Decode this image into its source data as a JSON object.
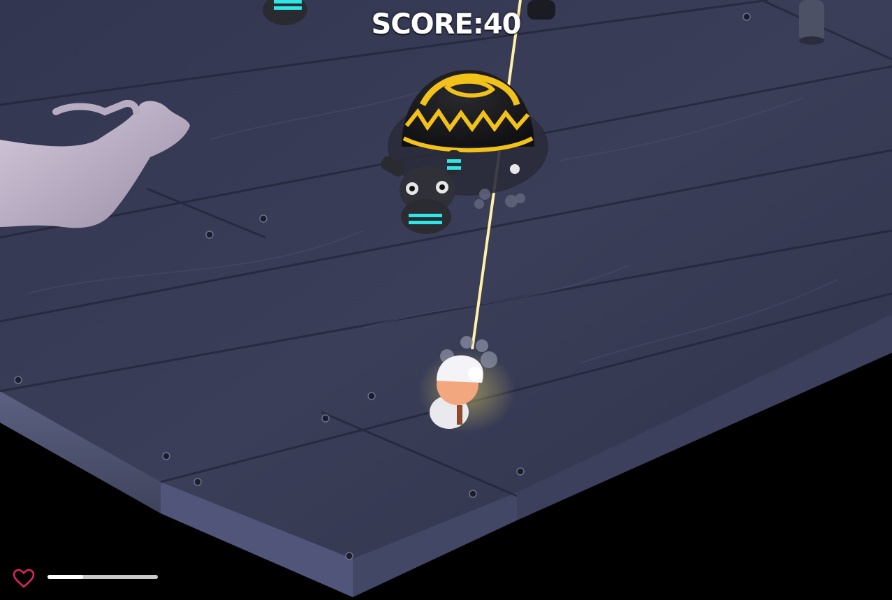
{
  "hud": {
    "score_label": "SCORE",
    "score_separator": ":",
    "score_value": "40",
    "health_fraction": 0.32
  },
  "colors": {
    "floor": "#3b3f58",
    "floor_dark": "#2c2f44",
    "beam": "#ffe98a",
    "enemy_stripe_yellow": "#f2c21a",
    "enemy_stripe_cyan": "#2ee6e6",
    "heart": "#e0245e"
  },
  "icons": {
    "health": "heart-icon"
  }
}
